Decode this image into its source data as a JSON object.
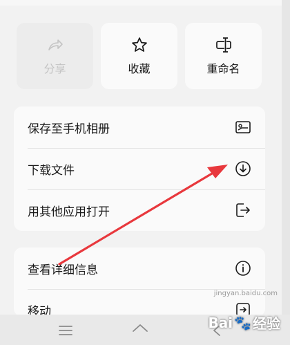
{
  "top_actions": [
    {
      "label": "分享",
      "icon": "share-icon",
      "disabled": true
    },
    {
      "label": "收藏",
      "icon": "star-icon",
      "disabled": false
    },
    {
      "label": "重命名",
      "icon": "rename-icon",
      "disabled": false
    }
  ],
  "menu_group_1": [
    {
      "label": "保存至手机相册",
      "icon": "image-icon"
    },
    {
      "label": "下载文件",
      "icon": "download-icon"
    },
    {
      "label": "用其他应用打开",
      "icon": "open-external-icon"
    }
  ],
  "menu_group_2": [
    {
      "label": "查看详细信息",
      "icon": "info-icon"
    },
    {
      "label": "移动",
      "icon": "move-icon"
    }
  ],
  "watermark": {
    "brand": "Bai",
    "brand2": "经验",
    "url": "jingyan.baidu.com"
  },
  "colors": {
    "arrow": "#e8383d",
    "card": "#fafafa",
    "sheet": "#f2f2f2"
  }
}
